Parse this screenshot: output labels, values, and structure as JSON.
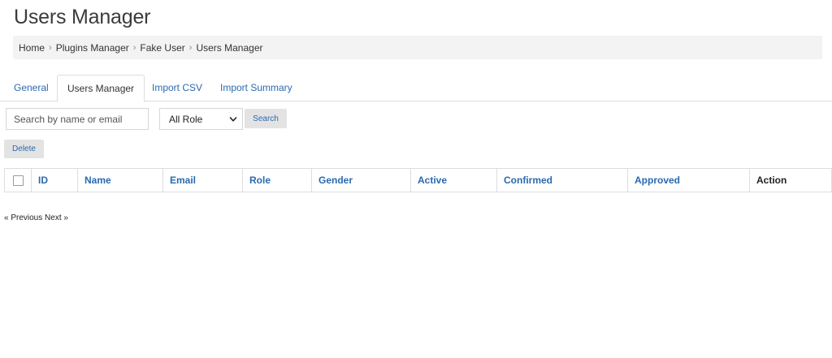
{
  "page": {
    "title": "Users Manager"
  },
  "breadcrumb": {
    "items": [
      "Home",
      "Plugins Manager",
      "Fake User",
      "Users Manager"
    ],
    "separator": "›"
  },
  "tabs": [
    {
      "label": "General",
      "active": false
    },
    {
      "label": "Users Manager",
      "active": true
    },
    {
      "label": "Import CSV",
      "active": false
    },
    {
      "label": "Import Summary",
      "active": false
    }
  ],
  "filters": {
    "search_placeholder": "Search by name or email",
    "search_value": "",
    "role_selected": "All Role",
    "search_button": "Search"
  },
  "actions": {
    "delete_button": "Delete"
  },
  "table": {
    "columns": [
      "ID",
      "Name",
      "Email",
      "Role",
      "Gender",
      "Active",
      "Confirmed",
      "Approved",
      "Action"
    ],
    "rows": []
  },
  "pagination": {
    "previous": "« Previous",
    "next": "Next »"
  },
  "colors": {
    "link": "#2a6ab0",
    "breadcrumb_bg": "#f3f3f3",
    "button_bg": "#e3e3e3",
    "border": "#dddddd"
  }
}
